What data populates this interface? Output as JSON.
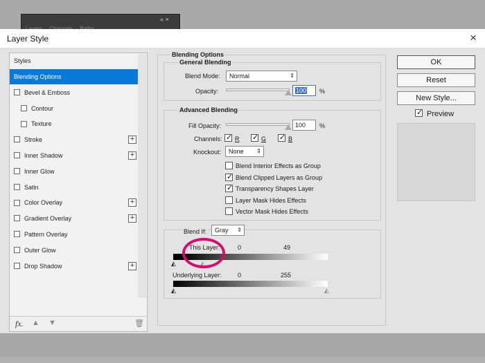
{
  "background": {
    "panel_tabs": [
      "Layers",
      "Channels",
      "Paths"
    ],
    "panel_controls": "«  ×"
  },
  "dialog": {
    "title": "Layer Style",
    "close": "×"
  },
  "styles_list": {
    "header": "Styles",
    "items": [
      {
        "label": "Blending Options",
        "checkbox": false,
        "selected": true,
        "plus": false,
        "sub": false
      },
      {
        "label": "Bevel & Emboss",
        "checkbox": true,
        "plus": false,
        "sub": false
      },
      {
        "label": "Contour",
        "checkbox": true,
        "plus": false,
        "sub": true
      },
      {
        "label": "Texture",
        "checkbox": true,
        "plus": false,
        "sub": true
      },
      {
        "label": "Stroke",
        "checkbox": true,
        "plus": true,
        "sub": false
      },
      {
        "label": "Inner Shadow",
        "checkbox": true,
        "plus": true,
        "sub": false
      },
      {
        "label": "Inner Glow",
        "checkbox": true,
        "plus": false,
        "sub": false
      },
      {
        "label": "Satin",
        "checkbox": true,
        "plus": false,
        "sub": false
      },
      {
        "label": "Color Overlay",
        "checkbox": true,
        "plus": true,
        "sub": false
      },
      {
        "label": "Gradient Overlay",
        "checkbox": true,
        "plus": true,
        "sub": false
      },
      {
        "label": "Pattern Overlay",
        "checkbox": true,
        "plus": false,
        "sub": false
      },
      {
        "label": "Outer Glow",
        "checkbox": true,
        "plus": false,
        "sub": false
      },
      {
        "label": "Drop Shadow",
        "checkbox": true,
        "plus": true,
        "sub": false
      }
    ],
    "footer": {
      "fx": "fx.",
      "up": "▲",
      "down": "▼",
      "trash": "🗑"
    }
  },
  "blending_options": {
    "title": "Blending Options",
    "general": {
      "title": "General Blending",
      "blend_mode_label": "Blend Mode:",
      "blend_mode_value": "Normal",
      "opacity_label": "Opacity:",
      "opacity_value": "100",
      "opacity_unit": "%"
    },
    "advanced": {
      "title": "Advanced Blending",
      "fill_opacity_label": "Fill Opacity:",
      "fill_opacity_value": "100",
      "fill_opacity_unit": "%",
      "channels_label": "Channels:",
      "channels": [
        "R",
        "G",
        "B"
      ],
      "knockout_label": "Knockout:",
      "knockout_value": "None",
      "options": [
        {
          "label": "Blend Interior Effects as Group",
          "checked": false
        },
        {
          "label": "Blend Clipped Layers as Group",
          "checked": true
        },
        {
          "label": "Transparency Shapes Layer",
          "checked": true
        },
        {
          "label": "Layer Mask Hides Effects",
          "checked": false
        },
        {
          "label": "Vector Mask Hides Effects",
          "checked": false
        }
      ]
    },
    "blend_if": {
      "label": "Blend If:",
      "value": "Gray",
      "this_layer_label": "This Layer:",
      "this_layer_low": "0",
      "this_layer_high": "49",
      "underlying_label": "Underlying Layer:",
      "underlying_low": "0",
      "underlying_high": "255"
    }
  },
  "buttons": {
    "ok": "OK",
    "reset": "Reset",
    "new_style": "New Style...",
    "preview_label": "Preview",
    "preview_checked": true
  },
  "colors": {
    "selected": "#0a79d8",
    "highlight_circle": "#d10f6c"
  }
}
